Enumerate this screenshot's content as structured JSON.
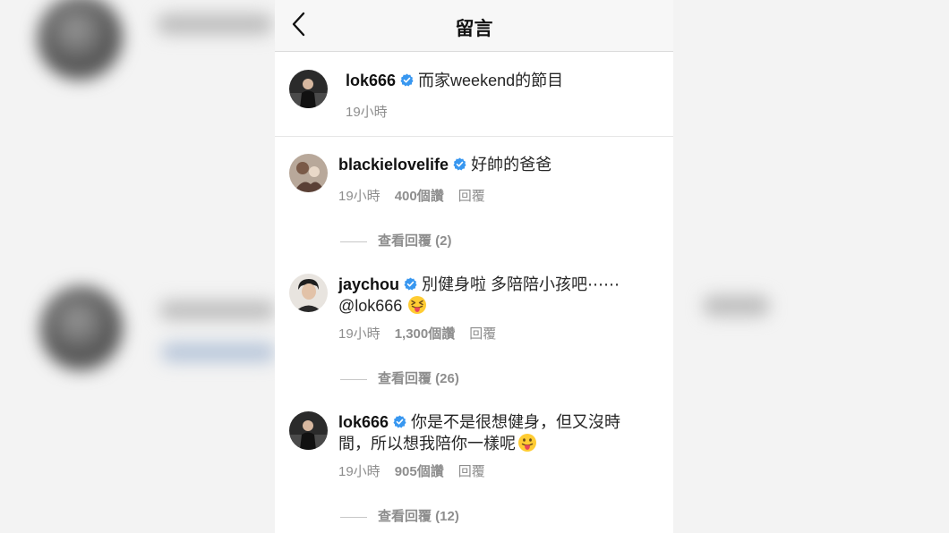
{
  "header": {
    "title": "留言"
  },
  "caption": {
    "username": "lok666",
    "text": "而家weekend的節目",
    "time": "19小時"
  },
  "comments": [
    {
      "username": "blackielovelife",
      "text": "好帥的爸爸",
      "time": "19小時",
      "likes": "400個讚",
      "reply": "回覆",
      "view_replies": "查看回覆 (2)"
    },
    {
      "username": "jaychou",
      "text": "別健身啦 多陪陪小孩吧⋯⋯",
      "text2": "@lok666",
      "time": "19小時",
      "likes": "1,300個讚",
      "reply": "回覆",
      "view_replies": "查看回覆 (26)"
    },
    {
      "username": "lok666",
      "text": "你是不是很想健身，但又沒時",
      "text2": "間，所以想我陪你一樣呢",
      "time": "19小時",
      "likes": "905個讚",
      "reply": "回覆",
      "view_replies": "查看回覆 (12)"
    }
  ],
  "icons": {
    "back": "chevron-left-icon",
    "verified": "verified-badge-icon",
    "emoji_tongue_wink": "squinting-tongue-emoji",
    "emoji_tongue": "tongue-emoji"
  },
  "colors": {
    "verified": "#3897f0",
    "meta_text": "#8e8e8e",
    "navbar_bg": "#f7f7f7"
  }
}
